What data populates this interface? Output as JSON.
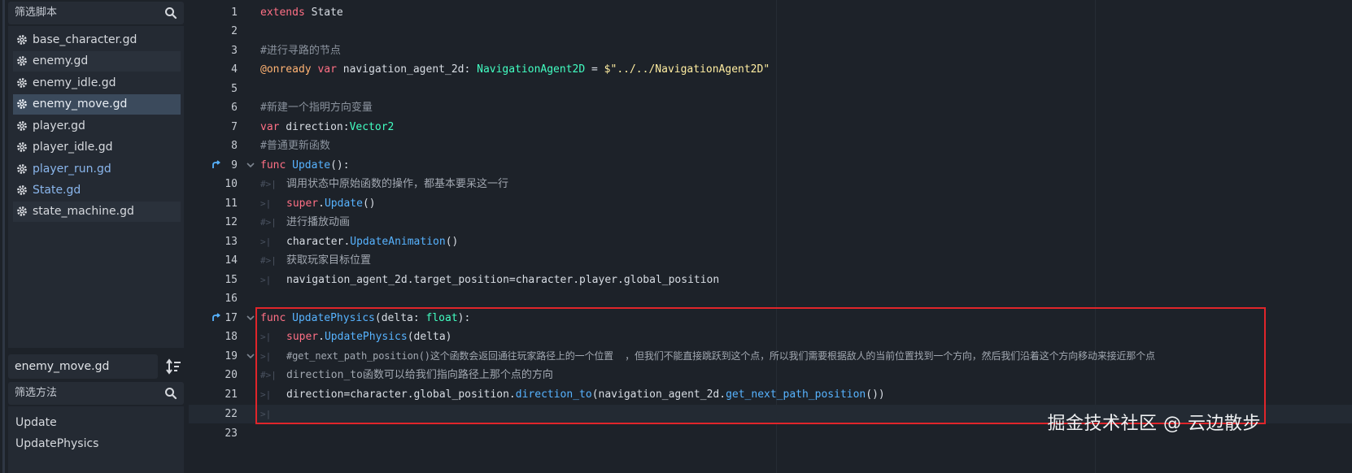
{
  "sidebar": {
    "script_filter_placeholder": "筛选脚本",
    "scripts": [
      {
        "label": "base_character.gd",
        "state": "normal"
      },
      {
        "label": "enemy.gd",
        "state": "alt"
      },
      {
        "label": "enemy_idle.gd",
        "state": "normal"
      },
      {
        "label": "enemy_move.gd",
        "state": "selected"
      },
      {
        "label": "player.gd",
        "state": "normal"
      },
      {
        "label": "player_idle.gd",
        "state": "normal"
      },
      {
        "label": "player_run.gd",
        "state": "blue"
      },
      {
        "label": "State.gd",
        "state": "blue"
      },
      {
        "label": "state_machine.gd",
        "state": "alt"
      }
    ],
    "current_file": "enemy_move.gd",
    "method_filter_placeholder": "筛选方法",
    "methods": [
      "Update",
      "UpdatePhysics"
    ]
  },
  "editor": {
    "lines": [
      {
        "n": "1",
        "code": "extends State"
      },
      {
        "n": "2",
        "code": ""
      },
      {
        "n": "3",
        "code": "#进行寻路的节点"
      },
      {
        "n": "4",
        "code": "@onready var navigation_agent_2d: NavigationAgent2D = $\"../../NavigationAgent2D\""
      },
      {
        "n": "5",
        "code": ""
      },
      {
        "n": "6",
        "code": "#新建一个指明方向变量"
      },
      {
        "n": "7",
        "code": "var direction:Vector2"
      },
      {
        "n": "8",
        "code": "#普通更新函数"
      },
      {
        "n": "9",
        "code": "func Update():"
      },
      {
        "n": "10",
        "code": "调用状态中原始函数的操作，都基本要呆这一行"
      },
      {
        "n": "11",
        "code": "super.Update()"
      },
      {
        "n": "12",
        "code": "进行播放动画"
      },
      {
        "n": "13",
        "code": "character.UpdateAnimation()"
      },
      {
        "n": "14",
        "code": "获取玩家目标位置"
      },
      {
        "n": "15",
        "code": "navigation_agent_2d.target_position=character.player.global_position"
      },
      {
        "n": "16",
        "code": ""
      },
      {
        "n": "17",
        "code": "func UpdatePhysics(delta: float):"
      },
      {
        "n": "18",
        "code": "super.UpdatePhysics(delta)"
      },
      {
        "n": "19",
        "code": "#get_next_path_position()这个函数会返回通往玩家路径上的一个位置  ，但我们不能直接跳跃到这个点，所以我们需要根据敌人的当前位置找到一个方向，然后我们沿着这个方向移动来接近那个点"
      },
      {
        "n": "20",
        "code": "direction_to函数可以给我们指向路径上那个点的方向"
      },
      {
        "n": "21",
        "code": "direction=character.global_position.direction_to(navigation_agent_2d.get_next_path_position())"
      },
      {
        "n": "22",
        "code": ""
      },
      {
        "n": "23",
        "code": ""
      }
    ]
  },
  "watermark": "掘金技术社区 @ 云边散步",
  "colors": {
    "keyword": "#ff7085",
    "type": "#42ffc2",
    "function": "#57b3ff",
    "string": "#ffeda1",
    "annotation": "#ffb373",
    "comment": "#8b939e",
    "highlight_box": "#e0252a"
  }
}
